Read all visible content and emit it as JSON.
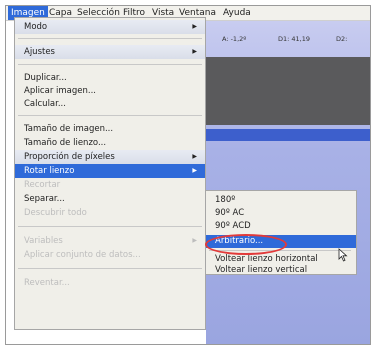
{
  "menubar": {
    "items": [
      {
        "label": "Imagen",
        "active": true
      },
      {
        "label": "Capa"
      },
      {
        "label": "Selección"
      },
      {
        "label": "Filtro"
      },
      {
        "label": "Vista"
      },
      {
        "label": "Ventana"
      },
      {
        "label": "Ayuda"
      }
    ]
  },
  "options_bar": {
    "a": "A: -1,2º",
    "d1": "D1: 41,19",
    "d2": "D2:"
  },
  "menu": {
    "modo": "Modo",
    "ajustes": "Ajustes",
    "duplicar": "Duplicar...",
    "aplicar": "Aplicar imagen...",
    "calcular": "Calcular...",
    "tamano_imagen": "Tamaño de imagen...",
    "tamano_lienzo": "Tamaño de lienzo...",
    "proporcion": "Proporción de píxeles",
    "rotar": "Rotar lienzo",
    "recortar": "Recortar",
    "separar": "Separar...",
    "descubrir": "Descubrir todo",
    "variables": "Variables",
    "aplicar_datos": "Aplicar conjunto de datos...",
    "reventar": "Reventar..."
  },
  "submenu": {
    "r180": "180º",
    "r90ac": "90º AC",
    "r90acd": "90º ACD",
    "arbitrario": "Arbitrario...",
    "voltear_h": "Voltear lienzo horizontal",
    "voltear_v": "Voltear lienzo vertical"
  },
  "colors": {
    "accent": "#2f6ad9",
    "highlight_circle": "#e23a3a"
  }
}
